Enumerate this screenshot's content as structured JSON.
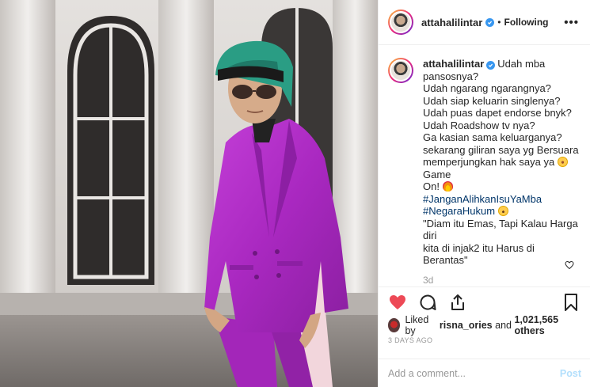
{
  "post": {
    "username": "attahalilintar",
    "follow_status": "Following",
    "separator": "•",
    "more_label": "•••",
    "caption_lines": [
      "Udah mba",
      "pansosnya?",
      "Udah ngarang ngarangnya?",
      "Udah siap keluarin singlenya?",
      "Udah puas dapet endorse bnyk?",
      "Udah Roadshow tv nya?",
      "Ga kasian sama keluarganya?",
      "sekarang giliran saya yg Bersuara",
      "memperjungkan hak saya ya",
      "Game",
      "On!",
      "#JanganAlihkanIsuYaMba",
      "#NegaraHukum",
      "\"Diam itu Emas, Tapi Kalau Harga diri",
      "kita di injak2 itu Harus di Berantas\""
    ],
    "time_ago": "3d",
    "liked_by_prefix": "Liked by",
    "liked_by_user": "risna_ories",
    "liked_by_and": "and",
    "likes_count": "1,021,565 others",
    "posted_date": "3 DAYS AGO",
    "comment_placeholder": "Add a comment...",
    "post_button": "Post"
  },
  "colors": {
    "accent_blue": "#3897f0",
    "heart_red": "#ed4956",
    "suit_purple": "#b530c9",
    "hashtag": "#003569"
  },
  "icons": [
    "verified-badge-icon",
    "heart-icon",
    "comment-icon",
    "share-icon",
    "bookmark-icon",
    "small-heart-icon"
  ]
}
